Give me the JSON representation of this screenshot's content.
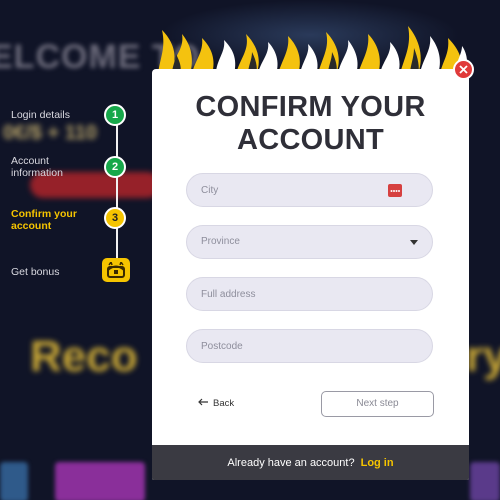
{
  "background": {
    "welcome_text": "ELCOME TO",
    "bonus_text": "0€/$ + 110",
    "record_text": "Reco",
    "record_tail": "ry"
  },
  "steps": [
    {
      "label": "Login details",
      "number": "1",
      "state": "done"
    },
    {
      "label": "Account information",
      "number": "2",
      "state": "done"
    },
    {
      "label": "Confirm your account",
      "number": "3",
      "state": "active"
    },
    {
      "label": "Get bonus",
      "number": "",
      "state": "pending",
      "icon": "treasure-chest-icon"
    }
  ],
  "modal": {
    "title_line1": "CONFIRM YOUR",
    "title_line2": "ACCOUNT",
    "fields": {
      "city": {
        "placeholder": "City",
        "icon": "dots-icon"
      },
      "province": {
        "placeholder": "Province",
        "icon": "caret-down-icon"
      },
      "address": {
        "placeholder": "Full address"
      },
      "postcode": {
        "placeholder": "Postcode"
      }
    },
    "back_label": "Back",
    "next_label": "Next step",
    "footer": {
      "text": "Already have an account?",
      "login_label": "Log in"
    }
  },
  "colors": {
    "accent": "#f5c400",
    "done": "#17a84a",
    "close": "#e03a3a",
    "footer_bg": "#3a3a42"
  }
}
